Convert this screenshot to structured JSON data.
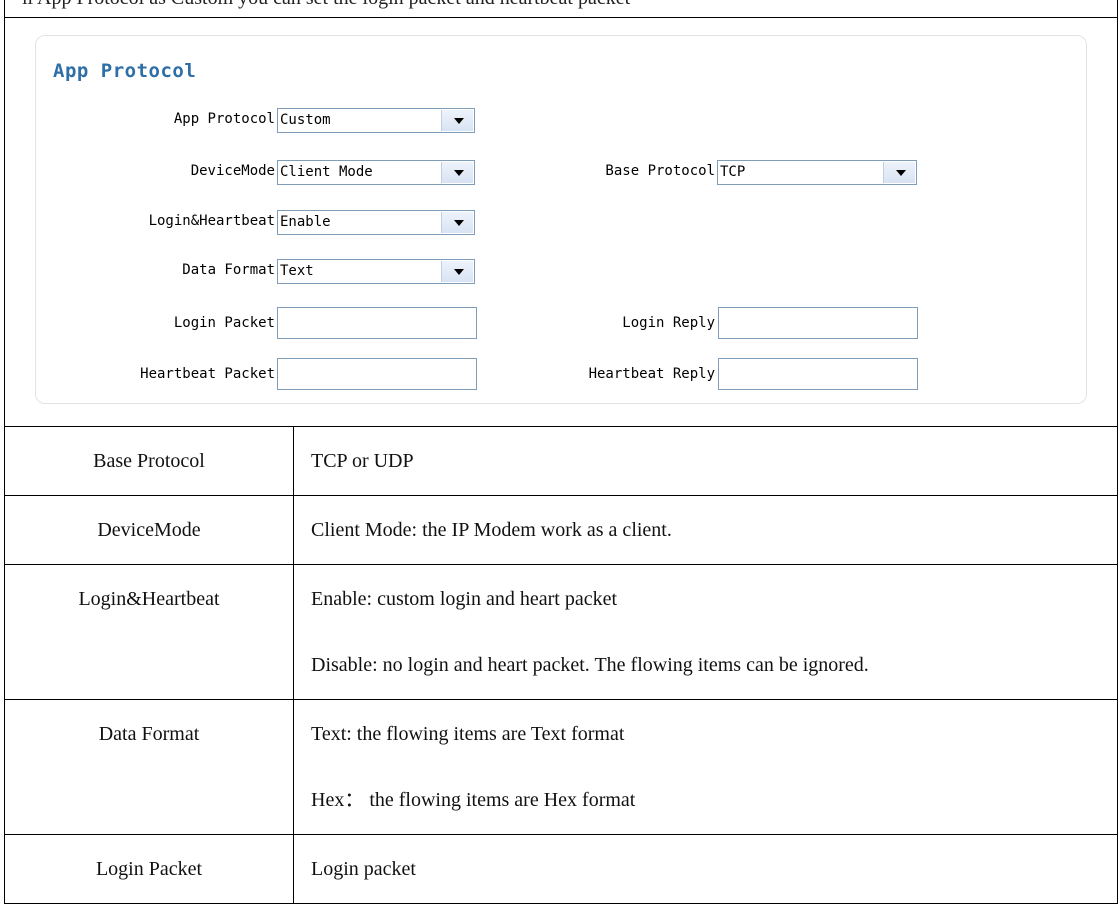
{
  "doc": {
    "top_line": "ll App Protocol as Custom you can set the login packet and heartbeat packet"
  },
  "panel": {
    "title": "App Protocol",
    "fields": {
      "app_protocol": {
        "label": "App Protocol",
        "value": "Custom"
      },
      "device_mode": {
        "label": "DeviceMode",
        "value": "Client Mode"
      },
      "base_protocol": {
        "label": "Base Protocol",
        "value": "TCP"
      },
      "login_heartbeat": {
        "label": "Login&Heartbeat",
        "value": "Enable"
      },
      "data_format": {
        "label": "Data Format",
        "value": "Text"
      },
      "login_packet": {
        "label": "Login Packet",
        "value": ""
      },
      "login_reply": {
        "label": "Login Reply",
        "value": ""
      },
      "heartbeat_packet": {
        "label": "Heartbeat Packet",
        "value": ""
      },
      "heartbeat_reply": {
        "label": "Heartbeat Reply",
        "value": ""
      }
    }
  },
  "table": {
    "rows": [
      {
        "name": "Base Protocol",
        "desc": [
          "TCP or UDP"
        ]
      },
      {
        "name": "DeviceMode",
        "desc": [
          "Client Mode: the IP Modem work as a client."
        ]
      },
      {
        "name": "Login&Heartbeat",
        "desc": [
          "Enable: custom login and heart packet",
          "Disable: no login and heart packet. The flowing items can be ignored."
        ]
      },
      {
        "name": "Data Format",
        "desc": [
          "Text: the flowing items are Text format",
          "Hex： the flowing items are Hex format"
        ]
      },
      {
        "name": "Login Packet",
        "desc": [
          "Login packet"
        ]
      }
    ]
  }
}
